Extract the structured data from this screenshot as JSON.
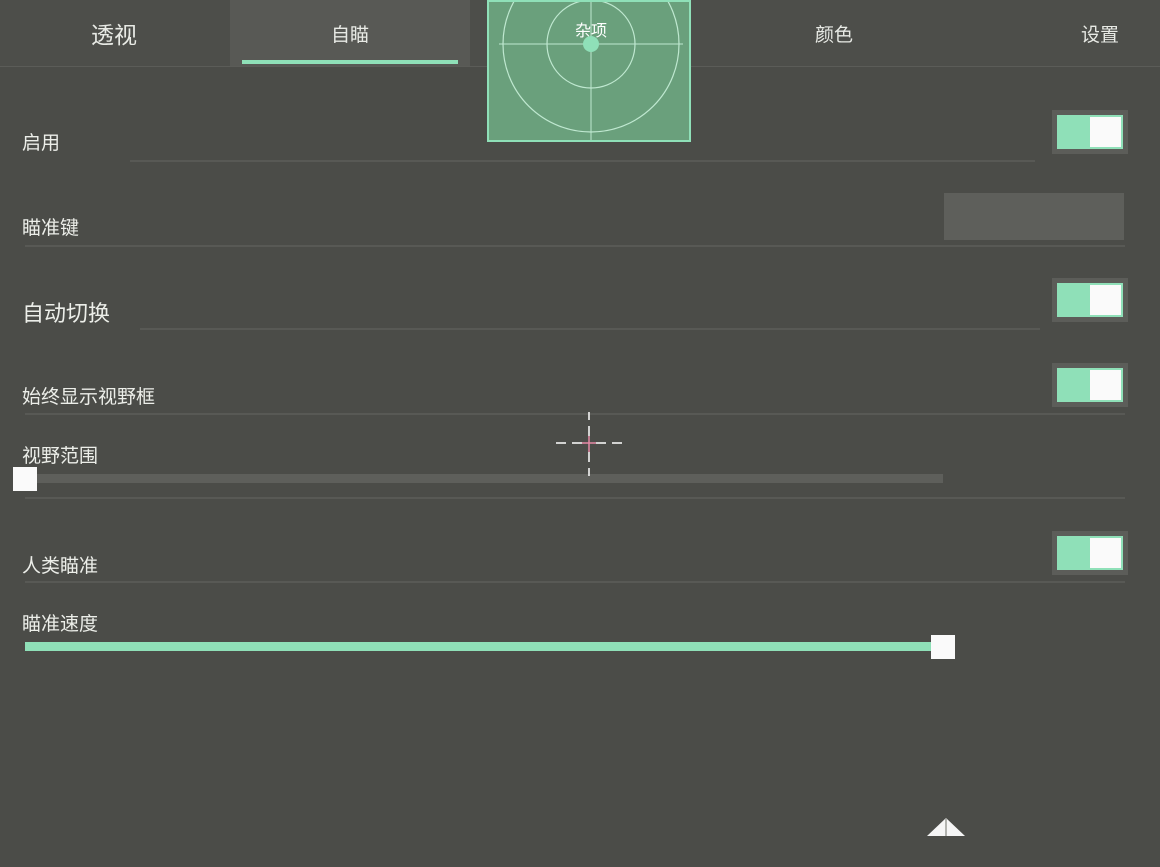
{
  "tabs": [
    {
      "label": "透视",
      "active": false
    },
    {
      "label": "自瞄",
      "active": true
    },
    {
      "label": "杂项",
      "active": false
    },
    {
      "label": "颜色",
      "active": false
    },
    {
      "label": "设置",
      "active": false
    }
  ],
  "settings": {
    "enable": {
      "label": "启用",
      "on": true
    },
    "aim_key": {
      "label": "瞄准键",
      "value": ""
    },
    "auto_switch": {
      "label": "自动切换",
      "on": true
    },
    "always_show_fov": {
      "label": "始终显示视野框",
      "on": true
    },
    "fov_range": {
      "label": "视野范围",
      "value_fraction": 0.0
    },
    "humanized_aim": {
      "label": "人类瞄准",
      "on": true
    },
    "aim_speed": {
      "label": "瞄准速度",
      "value_fraction": 1.0
    }
  },
  "icons": {
    "radar": "radar-icon",
    "crosshair": "crosshair-icon",
    "collapse": "chevron-up-icon"
  },
  "colors": {
    "accent": "#8fe0b8",
    "background": "#4b4c48",
    "crosshair_center": "#e58aa6"
  }
}
